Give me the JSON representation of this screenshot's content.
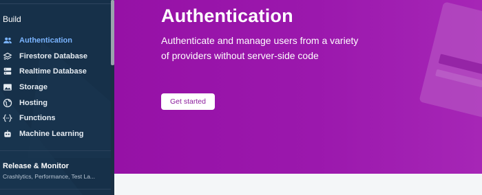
{
  "sidebar": {
    "section_title": "Build",
    "items": [
      {
        "label": "Authentication",
        "icon": "users-icon",
        "active": true
      },
      {
        "label": "Firestore Database",
        "icon": "firestore-icon",
        "active": false
      },
      {
        "label": "Realtime Database",
        "icon": "database-icon",
        "active": false
      },
      {
        "label": "Storage",
        "icon": "image-icon",
        "active": false
      },
      {
        "label": "Hosting",
        "icon": "globe-icon",
        "active": false
      },
      {
        "label": "Functions",
        "icon": "braces-icon",
        "active": false
      },
      {
        "label": "Machine Learning",
        "icon": "robot-icon",
        "active": false
      }
    ],
    "release": {
      "title": "Release & Monitor",
      "subtitle": "Crashlytics, Performance, Test La..."
    }
  },
  "hero": {
    "title": "Authentication",
    "description": "Authenticate and manage users from a variety of providers without server-side code",
    "button_label": "Get started"
  },
  "colors": {
    "sidebar_bg": "#163049",
    "active_item": "#7ab4ff",
    "hero_bg": "#9b18ad",
    "button_text": "#8a1a9c"
  }
}
